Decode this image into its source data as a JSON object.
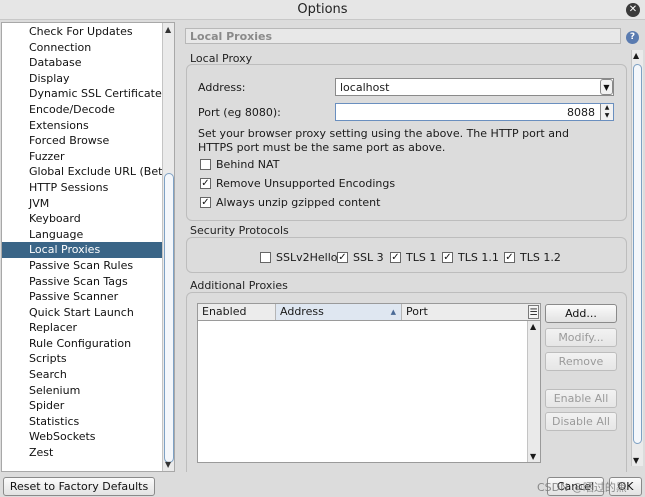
{
  "window": {
    "title": "Options"
  },
  "tree": {
    "items": [
      "Check For Updates",
      "Connection",
      "Database",
      "Display",
      "Dynamic SSL Certificates",
      "Encode/Decode",
      "Extensions",
      "Forced Browse",
      "Fuzzer",
      "Global Exclude URL (Beta",
      "HTTP Sessions",
      "JVM",
      "Keyboard",
      "Language",
      "Local Proxies",
      "Passive Scan Rules",
      "Passive Scan Tags",
      "Passive Scanner",
      "Quick Start Launch",
      "Replacer",
      "Rule Configuration",
      "Scripts",
      "Search",
      "Selenium",
      "Spider",
      "Statistics",
      "WebSockets",
      "Zest"
    ],
    "selected": "Local Proxies"
  },
  "panel": {
    "title": "Local Proxies"
  },
  "local_proxy": {
    "group_title": "Local Proxy",
    "address_label": "Address:",
    "address_value": "localhost",
    "port_label": "Port (eg 8080):",
    "port_value": "8088",
    "info_line1": "Set your browser proxy setting using the above.  The HTTP port and",
    "info_line2": "HTTPS port must be the same port as above.",
    "behind_nat": {
      "label": "Behind NAT",
      "checked": false
    },
    "remove_encodings": {
      "label": "Remove Unsupported Encodings",
      "checked": true
    },
    "unzip_gzip": {
      "label": "Always unzip gzipped content",
      "checked": true
    }
  },
  "security_protocols": {
    "group_title": "Security Protocols",
    "items": [
      {
        "label": "SSLv2Hello",
        "checked": false
      },
      {
        "label": "SSL 3",
        "checked": true
      },
      {
        "label": "TLS 1",
        "checked": true
      },
      {
        "label": "TLS 1.1",
        "checked": true
      },
      {
        "label": "TLS 1.2",
        "checked": true
      }
    ]
  },
  "additional_proxies": {
    "group_title": "Additional Proxies",
    "columns": [
      "Enabled",
      "Address",
      "Port"
    ],
    "sorted_column": "Address",
    "buttons": {
      "add": "Add...",
      "modify": "Modify...",
      "remove": "Remove",
      "enable_all": "Enable All",
      "disable_all": "Disable All"
    }
  },
  "footer": {
    "reset": "Reset to Factory Defaults",
    "cancel": "Cancel",
    "ok": "OK",
    "watermark": "CSDN @晒过的黑"
  }
}
